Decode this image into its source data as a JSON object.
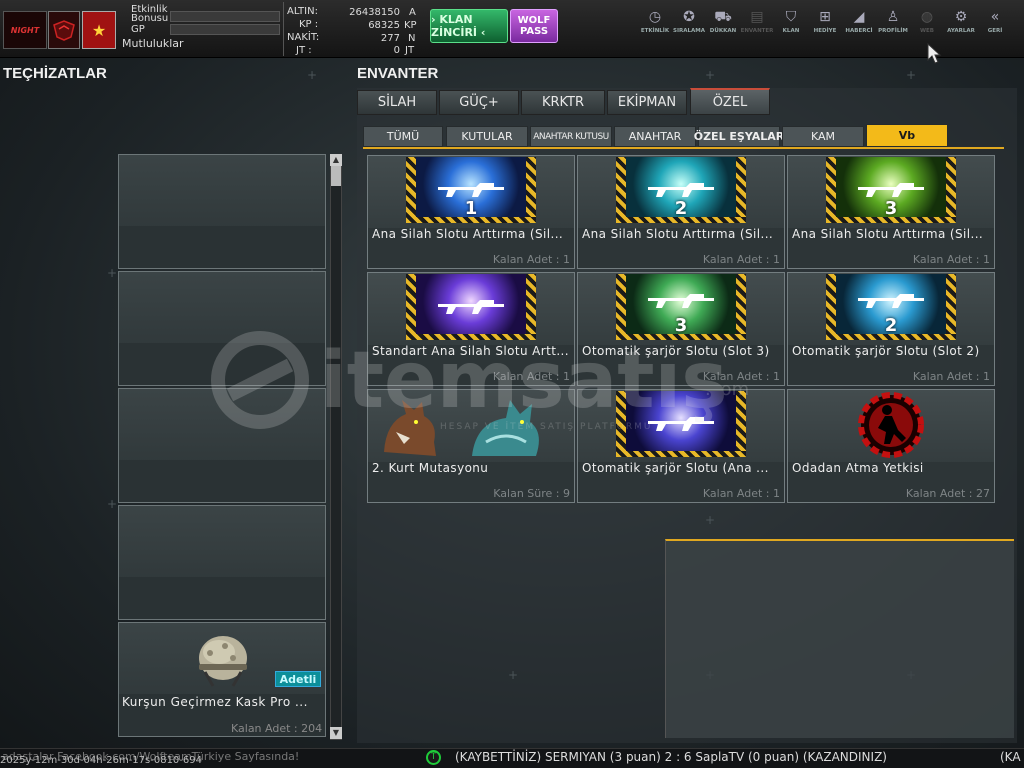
{
  "topbar": {
    "logo_text": "NIGHT",
    "etkinlik_label": "Etkinlik",
    "bonus_label": "Bonusu",
    "gp_label": "GP",
    "mutluluklar_label": "Mutluluklar",
    "currencies": [
      {
        "label": "ALTIN:",
        "value": "26438150",
        "unit": "A"
      },
      {
        "label": "KP :",
        "value": "68325",
        "unit": "KP"
      },
      {
        "label": "NAKİT:",
        "value": "277",
        "unit": "N"
      },
      {
        "label": "JT :",
        "value": "0",
        "unit": "JT"
      }
    ],
    "klan_button": "› KLAN ZİNCİRİ ‹",
    "wolf_line1": "WOLF",
    "wolf_line2": "PASS",
    "nav": [
      {
        "label": "ETKİNLİK",
        "icon": "stopwatch-icon",
        "glyph": "◷"
      },
      {
        "label": "SIRALAMA",
        "icon": "medal-icon",
        "glyph": "✪"
      },
      {
        "label": "DÜKKAN",
        "icon": "cart-icon",
        "glyph": "⛟"
      },
      {
        "label": "ENVANTER",
        "icon": "inventory-icon",
        "glyph": "▤"
      },
      {
        "label": "KLAN",
        "icon": "shield-icon",
        "glyph": "⛉"
      },
      {
        "label": "HEDİYE",
        "icon": "gift-icon",
        "glyph": "⊞"
      },
      {
        "label": "HABERCİ",
        "icon": "megaphone-icon",
        "glyph": "◢"
      },
      {
        "label": "PROFİLİM",
        "icon": "profile-icon",
        "glyph": "♙"
      },
      {
        "label": "WEB",
        "icon": "globe-icon",
        "glyph": "◍"
      },
      {
        "label": "AYARLAR",
        "icon": "gear-icon",
        "glyph": "⚙"
      },
      {
        "label": "GERİ",
        "icon": "back-chevron-icon",
        "glyph": "«"
      }
    ]
  },
  "left": {
    "heading": "TEÇHİZATLAR",
    "item": {
      "badge": "Adetli",
      "name": "Kurşun Geçirmez Kask Pro ...",
      "count": "Kalan Adet : 204"
    }
  },
  "inventory": {
    "heading": "ENVANTER",
    "tabs": [
      "SİLAH",
      "GÜÇ+",
      "KRKTR",
      "EKİPMAN",
      "ÖZEL"
    ],
    "subtabs": [
      "TÜMÜ",
      "KUTULAR",
      "ANAHTAR KUTUSU",
      "ANAHTAR",
      "ÖZEL EŞYALAR",
      "KAM",
      "Vb"
    ],
    "items": [
      {
        "name": "Ana Silah Slotu Arttırma (Sil...",
        "count": "Kalan Adet : 1",
        "num": "1"
      },
      {
        "name": "Ana Silah Slotu Arttırma (Sil...",
        "count": "Kalan Adet : 1",
        "num": "2"
      },
      {
        "name": "Ana Silah Slotu Arttırma (Sil...",
        "count": "Kalan Adet : 1",
        "num": "3"
      },
      {
        "name": "Standart Ana Silah Slotu Artt...",
        "count": "Kalan Adet : 1",
        "num": ""
      },
      {
        "name": "Otomatik şarjör Slotu (Slot 3)",
        "count": "Kalan Adet : 1",
        "num": "3"
      },
      {
        "name": "Otomatik şarjör Slotu (Slot 2)",
        "count": "Kalan Adet : 1",
        "num": "2"
      },
      {
        "name": "2. Kurt Mutasyonu",
        "count": "Kalan Süre : 9",
        "num": ""
      },
      {
        "name": "Otomatik şarjör Slotu (Ana ...",
        "count": "Kalan Adet : 1",
        "num": ""
      },
      {
        "name": "Odadan Atma Yetkisi",
        "count": "Kalan Adet : 27",
        "num": ""
      }
    ]
  },
  "watermark": {
    "brand": "itemsatış",
    "domain": ".com",
    "tagline": "HESAP VE İTEM SATIŞ PLATFORMU"
  },
  "ticker": {
    "left_text": "2025y-12m-30d-04h-26m-17s-0810-694",
    "left_text_behind": "adaştalar Facebook.com/WolfteamTürkiye Sayfasında!",
    "main_text": "(KAYBETTİNİZ) SERMIYAN (3 puan) 2 : 6 SaplaTV (0 puan) (KAZANDINIZ)",
    "right_text": "(KA"
  },
  "colors": {
    "accent_gold": "#f3ba19",
    "active_tab_top": "#c94d3a",
    "klan_green": "#34b86a",
    "wolf_purple": "#c865e0"
  }
}
